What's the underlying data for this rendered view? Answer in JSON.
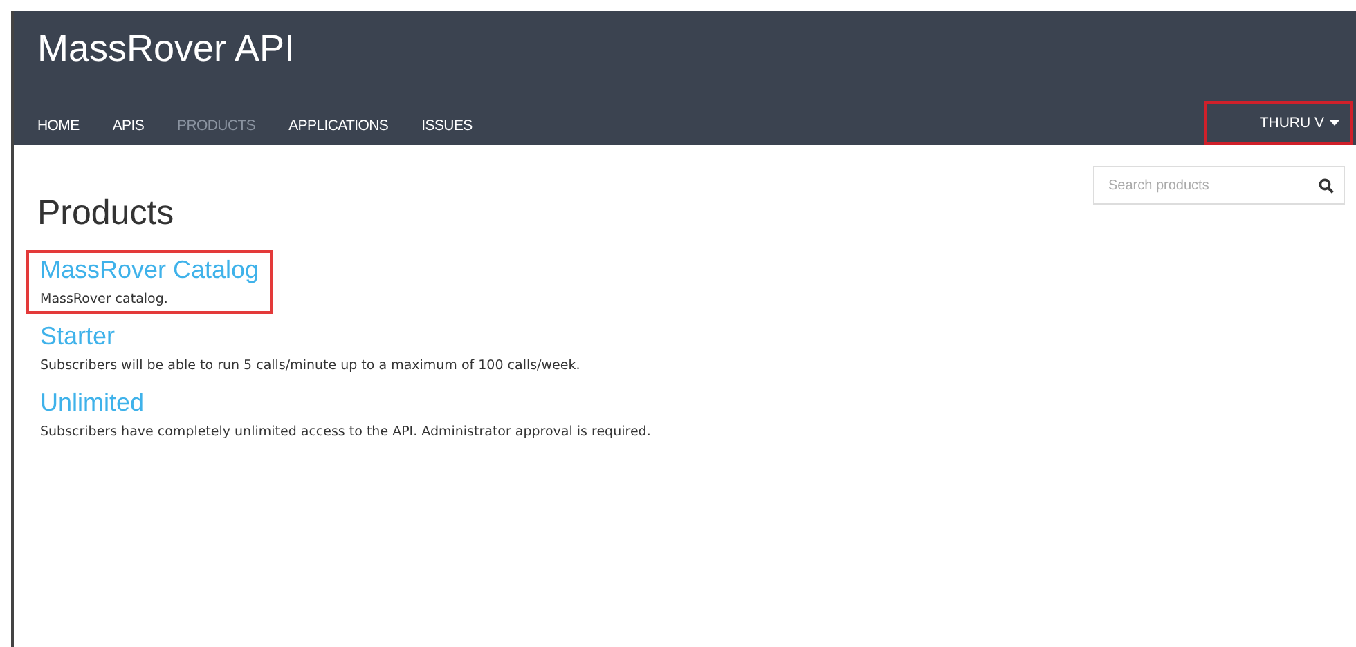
{
  "header": {
    "title": "MassRover API"
  },
  "nav": [
    {
      "label": "HOME",
      "selected": false
    },
    {
      "label": "APIS",
      "selected": false
    },
    {
      "label": "PRODUCTS",
      "selected": true
    },
    {
      "label": "APPLICATIONS",
      "selected": false
    },
    {
      "label": "ISSUES",
      "selected": false
    }
  ],
  "user_menu": {
    "label": "THURU V",
    "highlighted": true
  },
  "search": {
    "placeholder": "Search products"
  },
  "heading": "Products",
  "products": [
    {
      "name": "MassRover Catalog",
      "description": "MassRover catalog.",
      "highlighted": true
    },
    {
      "name": "Starter",
      "description": "Subscribers will be able to run 5 calls/minute up to a maximum of 100 calls/week.",
      "highlighted": false
    },
    {
      "name": "Unlimited",
      "description": "Subscribers have completely unlimited access to the API. Administrator approval is required.",
      "highlighted": false
    }
  ]
}
